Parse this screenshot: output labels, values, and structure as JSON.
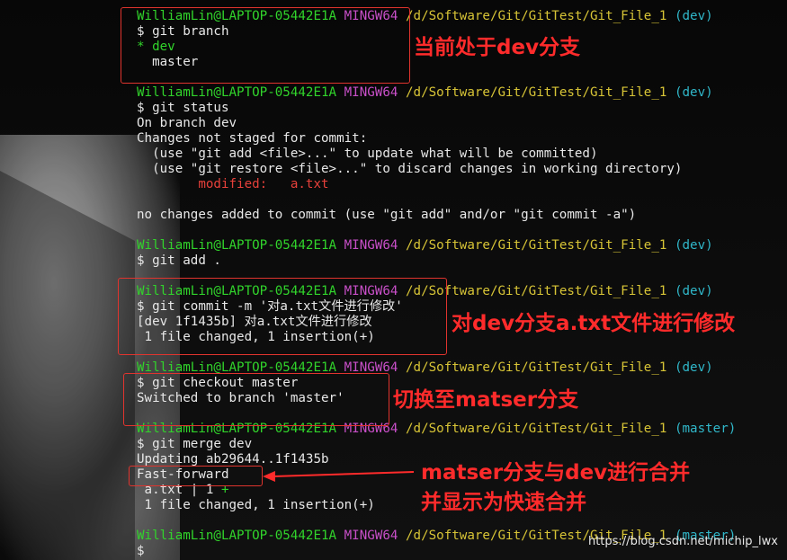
{
  "prompt": {
    "user": "WilliamLin@LAPTOP-05442E1A",
    "env": "MINGW64",
    "path": "/d/Software/Git/GitTest/Git_File_1",
    "branch_dev": "(dev)",
    "branch_master": "(master)"
  },
  "blocks": {
    "b1": {
      "cmd": "$ git branch",
      "current": "* dev",
      "other": "  master"
    },
    "b2": {
      "cmd": "$ git status",
      "l1": "On branch dev",
      "l2": "Changes not staged for commit:",
      "l3": "  (use \"git add <file>...\" to update what will be committed)",
      "l4": "  (use \"git restore <file>...\" to discard changes in working directory)",
      "modified_label": "        modified:   ",
      "modified_file": "a.txt",
      "l6": "no changes added to commit (use \"git add\" and/or \"git commit -a\")"
    },
    "b3": {
      "cmd": "$ git add ."
    },
    "b4": {
      "cmd": "$ git commit -m '对a.txt文件进行修改'",
      "l1": "[dev 1f1435b] 对a.txt文件进行修改",
      "l2": " 1 file changed, 1 insertion(+)"
    },
    "b5": {
      "cmd": "$ git checkout master",
      "l1": "Switched to branch 'master'"
    },
    "b6": {
      "cmd": "$ git merge dev",
      "l1": "Updating ab29644..1f1435b",
      "l2": "Fast-forward",
      "l3_text": " a.txt | 1 ",
      "l3_plus": "+",
      "l4": " 1 file changed, 1 insertion(+)"
    },
    "b7": {
      "cmd": "$"
    }
  },
  "annotations": {
    "a1": "当前处于dev分支",
    "a2": "对dev分支a.txt文件进行修改",
    "a3": "切换至matser分支",
    "a4_line1": "matser分支与dev进行合并",
    "a4_line2": "并显示为快速合并"
  },
  "watermark": "https://blog.csdn.net/michip_lwx",
  "colors": {
    "user": "#31d42b",
    "mingw": "#c84fc8",
    "path": "#d7c436",
    "branch": "#30b7c9",
    "annotation": "#ff2b2b"
  }
}
